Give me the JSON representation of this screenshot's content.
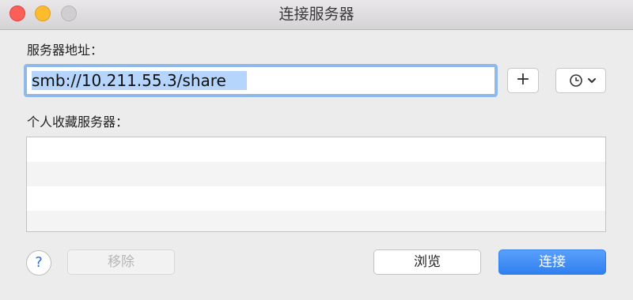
{
  "window": {
    "title": "连接服务器"
  },
  "server": {
    "label": "服务器地址：",
    "address_value": "smb://10.211.55.3/share",
    "add_glyph": "+"
  },
  "favorites": {
    "label": "个人收藏服务器：",
    "items": []
  },
  "buttons": {
    "help": "?",
    "remove": "移除",
    "browse": "浏览",
    "connect": "连接"
  },
  "icons": {
    "close": "close-icon",
    "minimize": "minimize-icon",
    "zoom": "zoom-icon",
    "history": "clock-icon",
    "dropdown": "chevron-down-icon"
  },
  "colors": {
    "accent": "#3b88f5",
    "selection": "#b5d5fd",
    "focus_ring": "#8fb9ea"
  }
}
